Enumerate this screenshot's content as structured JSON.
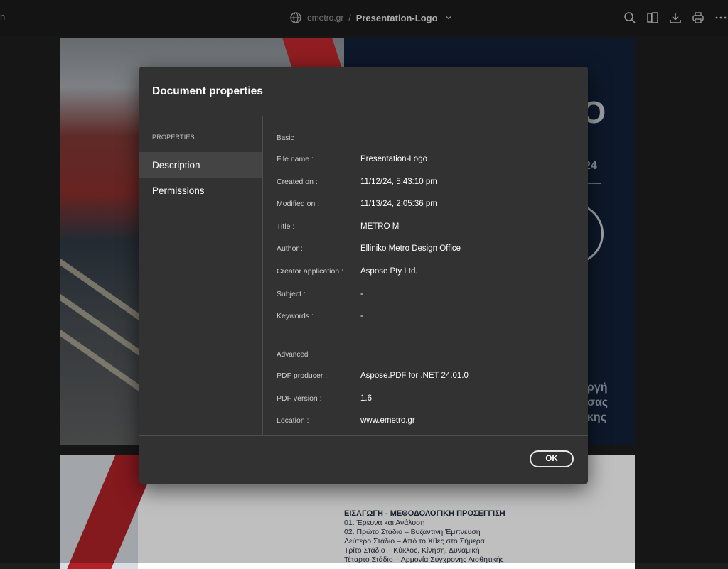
{
  "topbar": {
    "edge_text": "n",
    "domain": "emetro.gr",
    "separator": "/",
    "document_name": "Presentation-Logo",
    "icons": [
      "globe-icon",
      "chevron-down-icon",
      "search-icon",
      "page-thumbnails-icon",
      "download-icon",
      "print-icon",
      "more-options-icon"
    ]
  },
  "background": {
    "page1_letter": "O",
    "page1_year": "24",
    "page1_greek_lines": [
      "ργή",
      "σας",
      "κης"
    ],
    "page2_toc_heading": "ΕΙΣΑΓΩΓΗ - ΜΕΘΟΔΟΛΟΓΙΚΗ ΠΡΟΣΕΓΓΙΣΗ",
    "page2_toc_items": [
      "01. Έρευνα και Ανάλυση",
      "02. Πρώτο Στάδιο – Βυζαντινή Έμπνευση",
      "Δεύτερο Στάδιο – Από το Χθες στο Σήμερα",
      "Τρίτο Στάδιο – Κύκλος, Κίνηση, Δυναμική",
      "Τέταρτο Στάδιο – Αρμονία Σύγχρονης Αισθητικής"
    ]
  },
  "dialog": {
    "title": "Document properties",
    "sidebar": {
      "heading": "PROPERTIES",
      "items": [
        {
          "label": "Description",
          "active": true
        },
        {
          "label": "Permissions",
          "active": false
        }
      ]
    },
    "basic": {
      "heading": "Basic",
      "rows": [
        {
          "key": "File name :",
          "value": "Presentation-Logo"
        },
        {
          "key": "Created on :",
          "value": "11/12/24, 5:43:10 pm"
        },
        {
          "key": "Modified on :",
          "value": "11/13/24, 2:05:36 pm"
        },
        {
          "key": "Title :",
          "value": "METRO M"
        },
        {
          "key": "Author :",
          "value": "Elliniko Metro Design Office"
        },
        {
          "key": "Creator application :",
          "value": "Aspose Pty Ltd."
        },
        {
          "key": "Subject :",
          "value": "-"
        },
        {
          "key": "Keywords :",
          "value": "-"
        }
      ]
    },
    "advanced": {
      "heading": "Advanced",
      "rows": [
        {
          "key": "PDF producer :",
          "value": "Aspose.PDF for .NET 24.01.0"
        },
        {
          "key": "PDF version :",
          "value": "1.6"
        },
        {
          "key": "Location :",
          "value": "www.emetro.gr"
        }
      ]
    },
    "ok_label": "OK"
  },
  "colors": {
    "app_background": "#1e1e1e",
    "dialog_background": "#323232",
    "active_nav": "#444444",
    "accent_red": "#c1272d"
  }
}
